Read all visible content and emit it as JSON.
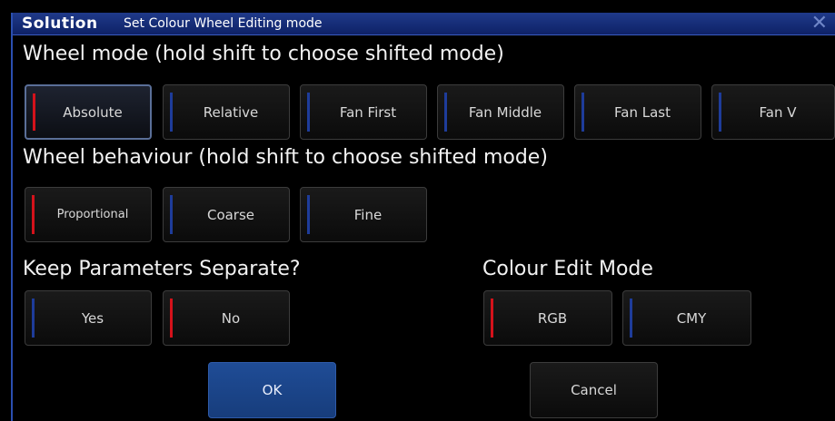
{
  "window": {
    "brand": "Solution",
    "title": "Set Colour Wheel Editing mode",
    "close_icon": "close-icon"
  },
  "wheel_mode": {
    "heading": "Wheel mode (hold shift to choose shifted mode)",
    "options": [
      "Absolute",
      "Relative",
      "Fan First",
      "Fan Middle",
      "Fan Last",
      "Fan V"
    ],
    "selected": "Absolute"
  },
  "wheel_behaviour": {
    "heading": "Wheel behaviour (hold shift to choose shifted mode)",
    "options": [
      "Proportional",
      "Coarse",
      "Fine"
    ],
    "selected": "Proportional"
  },
  "keep_separate": {
    "heading": "Keep Parameters Separate?",
    "options": [
      "Yes",
      "No"
    ],
    "selected": "No"
  },
  "colour_edit_mode": {
    "heading": "Colour Edit Mode",
    "options": [
      "RGB",
      "CMY"
    ],
    "selected": "RGB"
  },
  "actions": {
    "ok": "OK",
    "cancel": "Cancel"
  },
  "colors": {
    "selected_indicator": "#d4121b",
    "unselected_indicator": "#1e3c9a",
    "titlebar": "#1f3a8a",
    "ok_button": "#1f4c96"
  }
}
